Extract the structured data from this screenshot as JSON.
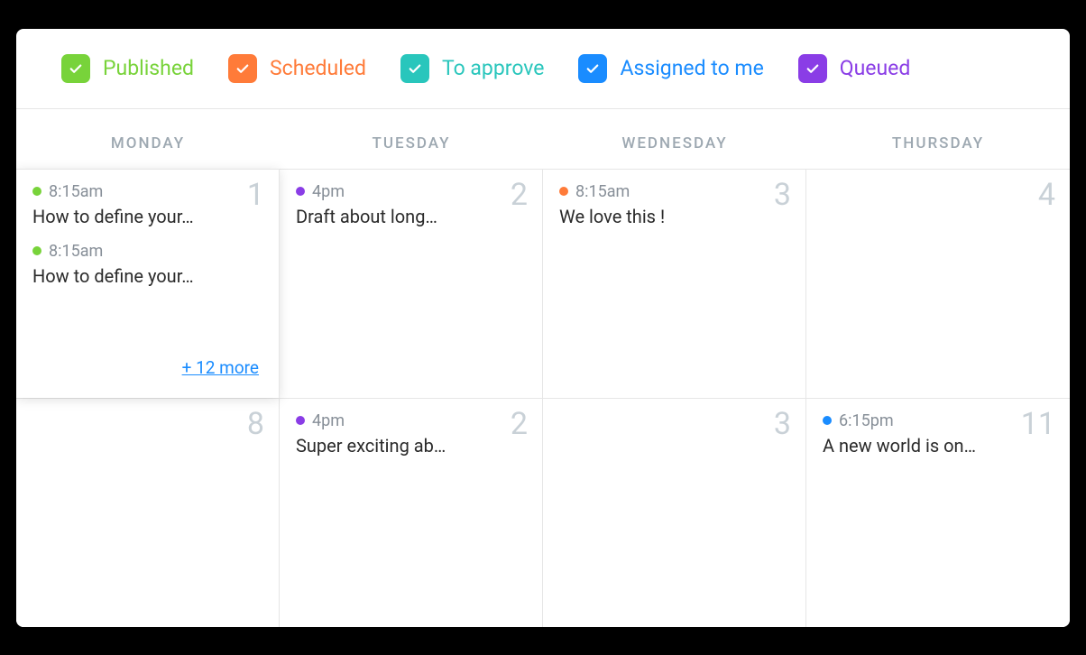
{
  "colors": {
    "published": "#78d33a",
    "scheduled": "#ff7b39",
    "to_approve": "#29c6bc",
    "assigned": "#1a8cff",
    "queued": "#8a3de6"
  },
  "filters": [
    {
      "key": "published",
      "label": "Published",
      "color": "#78d33a",
      "textColor": "#78d33a"
    },
    {
      "key": "scheduled",
      "label": "Scheduled",
      "color": "#ff7b39",
      "textColor": "#ff7b39"
    },
    {
      "key": "to_approve",
      "label": "To approve",
      "color": "#29c6bc",
      "textColor": "#29c6bc"
    },
    {
      "key": "assigned",
      "label": "Assigned to me",
      "color": "#1a8cff",
      "textColor": "#1a8cff"
    },
    {
      "key": "queued",
      "label": "Queued",
      "color": "#8a3de6",
      "textColor": "#8a3de6"
    }
  ],
  "weekdays": [
    "MONDAY",
    "TUESDAY",
    "WEDNESDAY",
    "THURSDAY"
  ],
  "cells": [
    {
      "date": "1",
      "raised": true,
      "events": [
        {
          "time": "8:15am",
          "title": "How to define your…",
          "color": "#78d33a"
        },
        {
          "time": "8:15am",
          "title": "How to define your…",
          "color": "#78d33a"
        }
      ],
      "more": "+ 12 more"
    },
    {
      "date": "2",
      "events": [
        {
          "time": "4pm",
          "title": "Draft about long…",
          "color": "#8a3de6"
        }
      ]
    },
    {
      "date": "3",
      "events": [
        {
          "time": "8:15am",
          "title": "We love this !",
          "color": "#ff7b39"
        }
      ]
    },
    {
      "date": "4",
      "events": []
    },
    {
      "date": "8",
      "events": []
    },
    {
      "date": "2",
      "events": [
        {
          "time": "4pm",
          "title": "Super exciting ab…",
          "color": "#8a3de6"
        }
      ]
    },
    {
      "date": "3",
      "events": []
    },
    {
      "date": "11",
      "events": [
        {
          "time": "6:15pm",
          "title": "A new world is on…",
          "color": "#1a8cff"
        }
      ]
    }
  ]
}
